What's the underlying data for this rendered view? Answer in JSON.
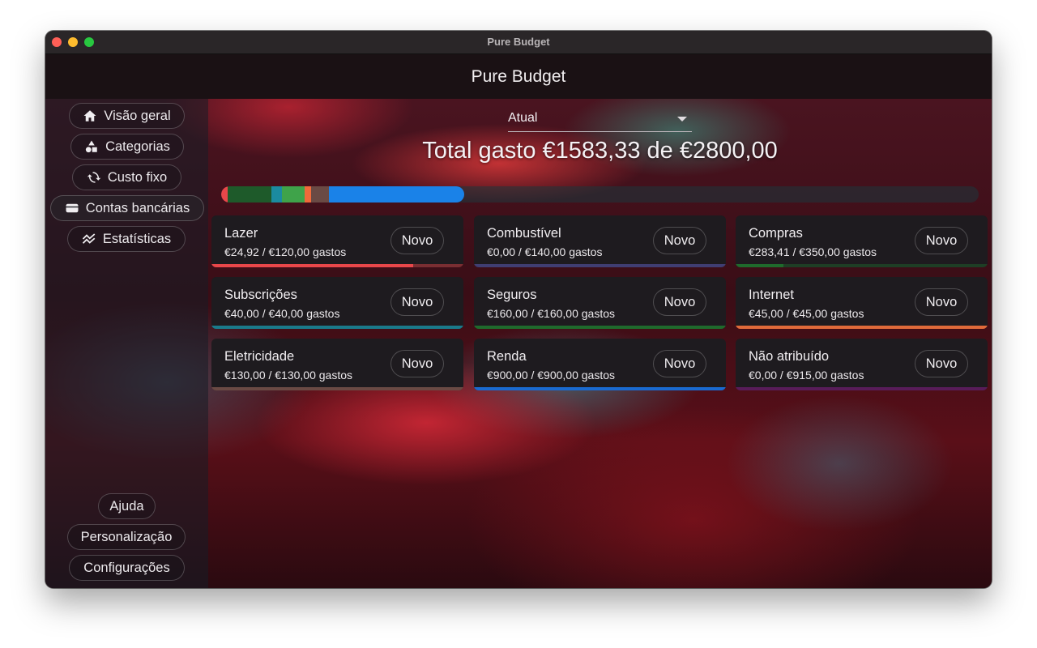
{
  "window": {
    "title": "Pure Budget"
  },
  "appbar": {
    "title": "Pure Budget"
  },
  "sidebar": {
    "items": [
      {
        "label": "Visão geral",
        "icon": "home-icon"
      },
      {
        "label": "Categorias",
        "icon": "shapes-icon"
      },
      {
        "label": "Custo fixo",
        "icon": "refresh-icon"
      },
      {
        "label": "Contas bancárias",
        "icon": "wallet-icon"
      },
      {
        "label": "Estatísticas",
        "icon": "chart-icon"
      }
    ],
    "bottom": [
      {
        "label": "Ajuda"
      },
      {
        "label": "Personalização"
      },
      {
        "label": "Configurações"
      }
    ]
  },
  "period_select": {
    "value": "Atual"
  },
  "total": {
    "text": "Total gasto €1583,33 de €2800,00"
  },
  "progress": {
    "segments": [
      {
        "value": 24.92,
        "color": "#e8474a"
      },
      {
        "value": 160.0,
        "color": "#1e5a2a"
      },
      {
        "value": 40.0,
        "color": "#1b8ba0"
      },
      {
        "value": 83.41,
        "color": "#3fa34a"
      },
      {
        "value": 24.0,
        "color": "#f06a3a"
      },
      {
        "value": 66.0,
        "color": "#6a4a44"
      },
      {
        "value": 500.0,
        "color": "#1a82e8"
      }
    ],
    "total": 2800
  },
  "cards": [
    {
      "name": "Lazer",
      "amount": "€24,92 / €120,00 gastos",
      "button": "Novo",
      "color": "#e8474a",
      "fraction": 0.8
    },
    {
      "name": "Combustível",
      "amount": "€0,00 / €140,00 gastos",
      "button": "Novo",
      "color": "#6a6ad8",
      "fraction": 0.0
    },
    {
      "name": "Compras",
      "amount": "€283,41 / €350,00 gastos",
      "button": "Novo",
      "color": "#1f6a2c",
      "fraction": 0.19
    },
    {
      "name": "Subscrições",
      "amount": "€40,00 / €40,00 gastos",
      "button": "Novo",
      "color": "#1a7a8a",
      "fraction": 1.0
    },
    {
      "name": "Seguros",
      "amount": "€160,00 / €160,00 gastos",
      "button": "Novo",
      "color": "#1f6a2c",
      "fraction": 1.0
    },
    {
      "name": "Internet",
      "amount": "€45,00 / €45,00 gastos",
      "button": "Novo",
      "color": "#e06a3a",
      "fraction": 1.0
    },
    {
      "name": "Eletricidade",
      "amount": "€130,00 / €130,00 gastos",
      "button": "Novo",
      "color": "#6a4a44",
      "fraction": 1.0
    },
    {
      "name": "Renda",
      "amount": "€900,00 / €900,00 gastos",
      "button": "Novo",
      "color": "#1a6ad0",
      "fraction": 1.0
    },
    {
      "name": "Não atribuído",
      "amount": "€0,00 / €915,00 gastos",
      "button": "Novo",
      "color": "#a020a0",
      "fraction": 0.0
    }
  ]
}
